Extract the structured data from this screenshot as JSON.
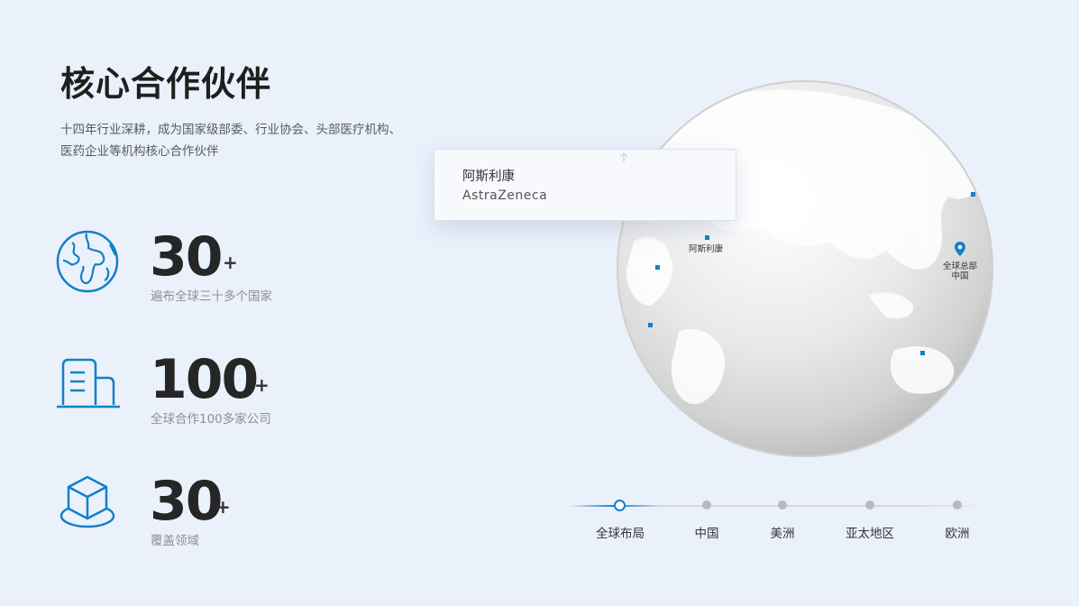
{
  "header": {
    "title": "核心合作伙伴",
    "subtitle_line1": "十四年行业深耕，成为国家级部委、行业协会、头部医疗机构、",
    "subtitle_line2": "医药企业等机构核心合作伙伴"
  },
  "stats": [
    {
      "value": "30",
      "suffix": "+",
      "description": "遍布全球三十多个国家",
      "icon": "globe-icon"
    },
    {
      "value": "100",
      "suffix": "+",
      "description": "全球合作100多家公司",
      "icon": "building-icon"
    },
    {
      "value": "30",
      "suffix": "+",
      "description": "覆盖领域",
      "icon": "cube-icon"
    }
  ],
  "tooltip": {
    "name_cn": "阿斯利康",
    "name_en": "AstraZeneca"
  },
  "map": {
    "labels": {
      "partner": "阿斯利康",
      "hq_line1": "全球总部",
      "hq_line2": "中国"
    },
    "accent_color": "#1180c8"
  },
  "timeline": {
    "items": [
      "全球布局",
      "中国",
      "美洲",
      "亚太地区",
      "欧洲"
    ],
    "active_index": 0
  }
}
